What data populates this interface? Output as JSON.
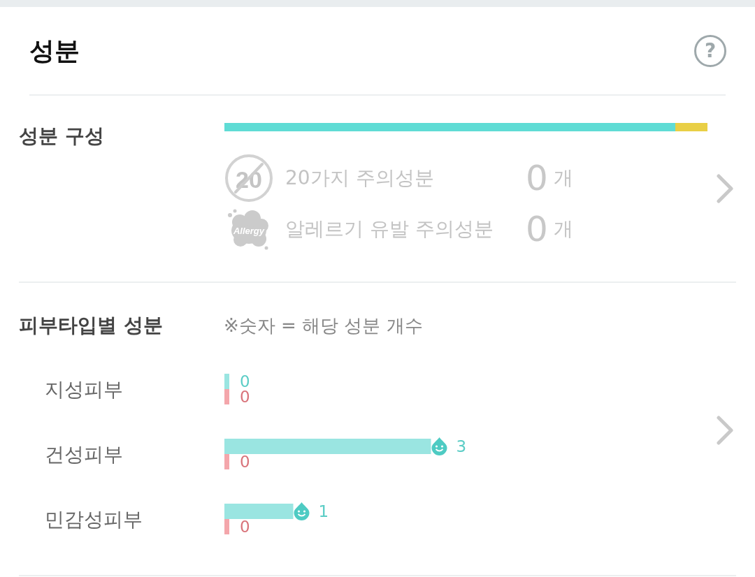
{
  "header": {
    "title": "성분",
    "help_button": "?"
  },
  "ingredient_composition": {
    "title": "성분 구성",
    "bar": {
      "level": 0.933
    },
    "caution_rows": [
      {
        "kind": "twenty",
        "emblem": "20",
        "label": "20가지 주의성분",
        "count": "0",
        "unit": "개"
      },
      {
        "kind": "allergy",
        "emblem": "Allergy",
        "label": "알레르기 유발 주의성분",
        "count": "0",
        "unit": "개"
      }
    ]
  },
  "skin_type_ingredients": {
    "title": "피부타입별 성분",
    "note": "※숫자 = 해당 성분 개수",
    "chart_data": {
      "type": "bar",
      "orientation": "horizontal",
      "categories": [
        "지성피부",
        "건성피부",
        "민감성피부"
      ],
      "series": [
        {
          "color": "#9ae5e1",
          "values": [
            0,
            3,
            1
          ]
        },
        {
          "color": "#f4a6ab",
          "values": [
            0,
            0,
            0
          ]
        }
      ],
      "data_labels": true
    }
  }
}
